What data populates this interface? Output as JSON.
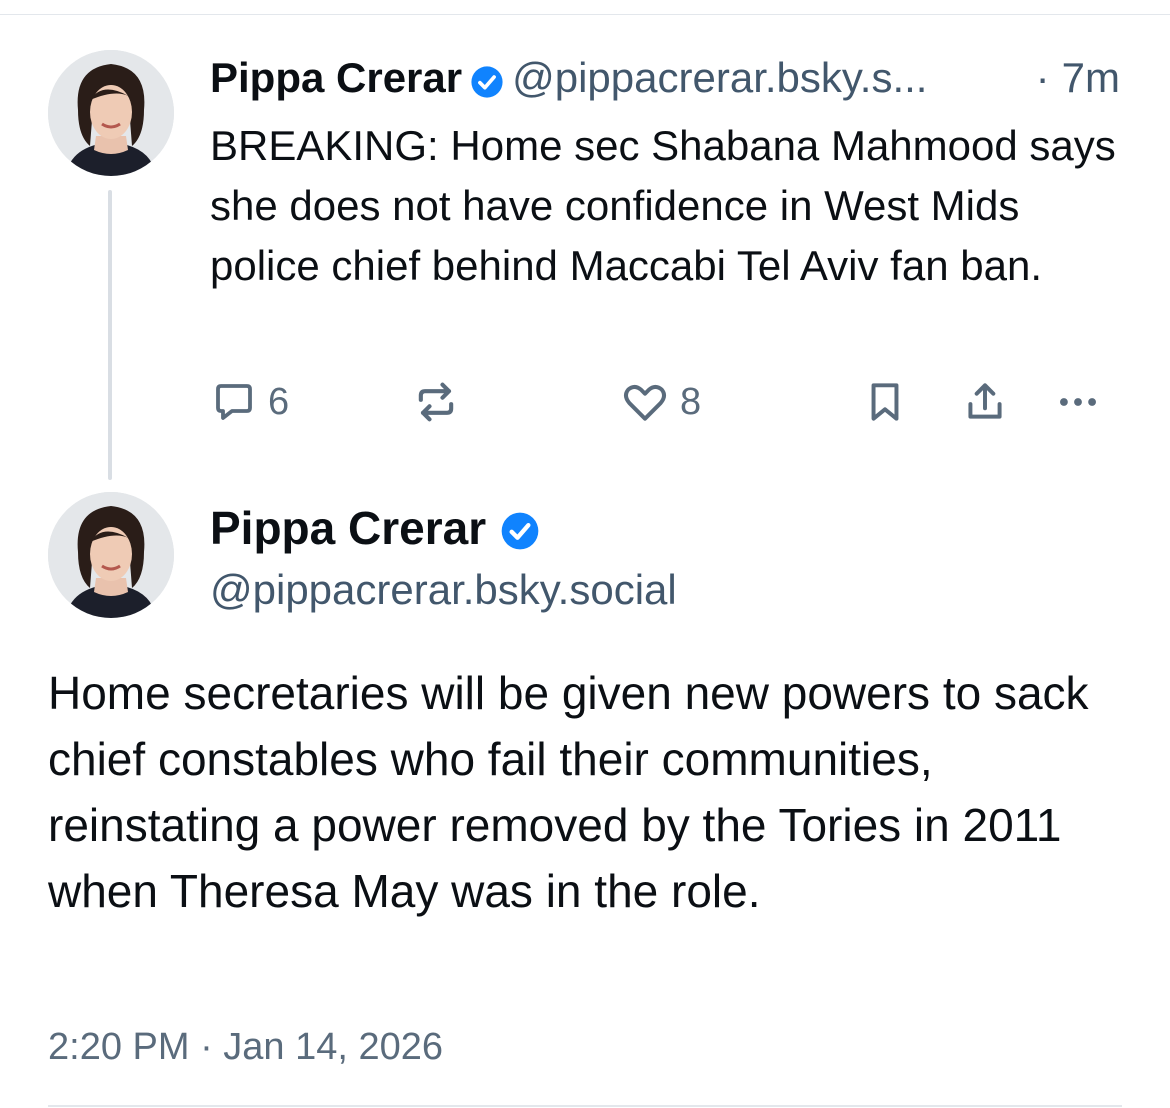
{
  "reply_post": {
    "author_name": "Pippa Crerar",
    "handle": "@pippacrerar.bsky.s...",
    "separator": "·",
    "time": "7m",
    "text": "BREAKING: Home sec Shabana Mahmood says she does not have confidence in West Mids police chief behind Maccabi Tel Aviv fan ban.",
    "actions": {
      "reply_count": "6",
      "like_count": "8"
    }
  },
  "main_post": {
    "author_name": "Pippa Crerar",
    "handle": "@pippacrerar.bsky.social",
    "text": "Home secretaries will be given new powers to sack chief constables who fail their communities, reinstating a power removed by the Tories in 2011 when Theresa May was in the role.",
    "timestamp": "2:20 PM · Jan 14, 2026"
  },
  "icons": {
    "verified": "verified-badge-icon",
    "reply": "speech-bubble-icon",
    "repost": "repost-arrows-icon",
    "like": "heart-icon",
    "bookmark": "bookmark-icon",
    "share": "share-upload-icon",
    "more": "more-dots-icon"
  },
  "colors": {
    "accent": "#1083fe",
    "text": "#0b0f14",
    "secondary": "#42576c",
    "icon": "#5a6b7c"
  }
}
